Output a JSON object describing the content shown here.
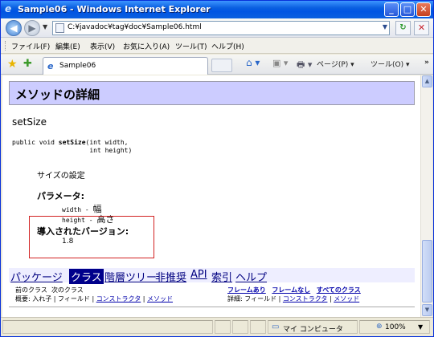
{
  "window": {
    "title": "Sample06 - Windows Internet Explorer",
    "minimize": "_",
    "maximize": "□",
    "close": "✕",
    "app_icon": "ie-logo-icon"
  },
  "address_bar": {
    "back": "◀",
    "forward": "▶",
    "dropdown": "▼",
    "url": "C:¥javadoc¥tag¥doc¥Sample06.html",
    "refresh": "↻",
    "stop": "✕"
  },
  "menu": {
    "items": [
      "ファイル(F)",
      "編集(E)",
      "表示(V)",
      "お気に入り(A)",
      "ツール(T)",
      "ヘルプ(H)"
    ]
  },
  "tabs": {
    "active_label": "Sample06",
    "commands": {
      "home": "⌂ ▾",
      "feeds": "▣ ▾",
      "print": "🖶 ▾",
      "page": "ページ(P) ▾",
      "tools": "ツール(O) ▾",
      "more": "»"
    }
  },
  "doc": {
    "section_title": "メソッドの詳細",
    "method_name": "setSize",
    "signature_prefix": "public void ",
    "signature_name": "setSize",
    "signature_rest": "(int width,",
    "signature_line2": "                    int height)",
    "description": "サイズの設定",
    "params_label": "パラメータ:",
    "param_width_name": "width",
    "param_width_sep": " - ",
    "param_width_desc": "幅",
    "param_height_name": "height",
    "param_height_sep": " - ",
    "param_height_desc": "高さ",
    "since_label": "導入されたバージョン:",
    "since_value": "1.8"
  },
  "navbar": {
    "package": "パッケージ",
    "class": "クラス",
    "tree": "階層ツリー",
    "deprecated": "非推奨",
    "api": "API",
    "index": "索引",
    "help": "ヘルプ"
  },
  "subnav": {
    "prev_class": "前のクラス",
    "next_class": "次のクラス",
    "summary": "概要:",
    "nested": "入れ子",
    "field": "フィールド",
    "constructor": "コンストラクタ",
    "method": "メソッド",
    "frames": "フレームあり",
    "no_frames": "フレームなし",
    "all_classes": "すべてのクラス",
    "detail": "詳細:",
    "detail_field": "フィールド",
    "detail_constructor": "コンストラクタ",
    "detail_method": "メソッド",
    "sep": "|"
  },
  "status": {
    "zone": "マイ コンピュータ",
    "zoom": "100%",
    "zoom_drop": "▼"
  },
  "colors": {
    "header_bg": "#ccccff",
    "navbar_bg": "#eeeeff",
    "active_nav": "#00008b",
    "annotation": "#d22222"
  }
}
